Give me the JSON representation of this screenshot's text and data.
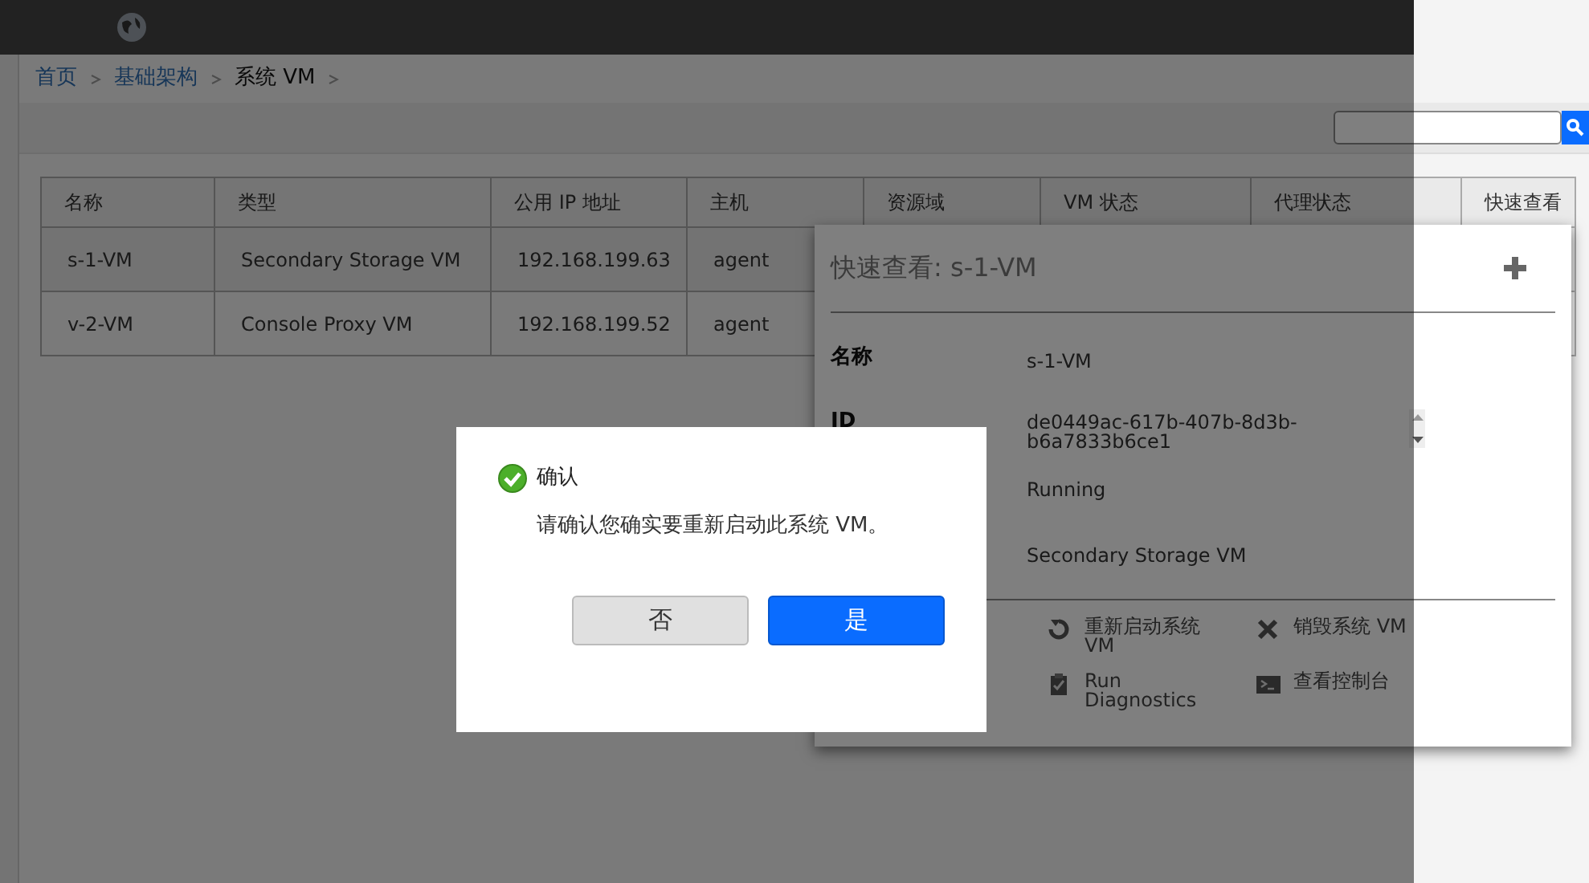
{
  "breadcrumb": [
    {
      "label": "首页",
      "kind": "link"
    },
    {
      "label": "基础架构",
      "kind": "link"
    },
    {
      "label": "系统 VM",
      "kind": "current"
    }
  ],
  "table": {
    "columns": [
      "名称",
      "类型",
      "公用 IP 地址",
      "主机",
      "资源域",
      "VM 状态",
      "代理状态",
      "快速查看"
    ],
    "rows": [
      {
        "cells": [
          "s-1-VM",
          "Secondary Storage VM",
          "192.168.199.63",
          "agent"
        ]
      },
      {
        "cells": [
          "v-2-VM",
          "Console Proxy VM",
          "192.168.199.52",
          "agent"
        ]
      }
    ]
  },
  "quick_view": {
    "title": "快速查看: s-1-VM",
    "fields": [
      {
        "label": "名称",
        "value": "s-1-VM"
      },
      {
        "label": "ID",
        "value": "de0449ac-617b-407b-8d3b-b6a7833b6ce1"
      },
      {
        "value": "Running"
      },
      {
        "value": "Secondary Storage VM"
      }
    ],
    "actions": [
      {
        "label": "重新启动系统 VM",
        "kind": "restart"
      },
      {
        "label": "销毁系统 VM",
        "kind": "destroy"
      },
      {
        "label": "Run Diagnostics",
        "kind": "diagnostics"
      },
      {
        "label": "查看控制台",
        "kind": "console"
      }
    ]
  },
  "dialog": {
    "title": "确认",
    "message": "请确认您确实要重新启动此系统 VM。",
    "buttons": [
      {
        "label": "否",
        "kind": "secondary"
      },
      {
        "label": "是",
        "kind": "primary"
      }
    ]
  }
}
